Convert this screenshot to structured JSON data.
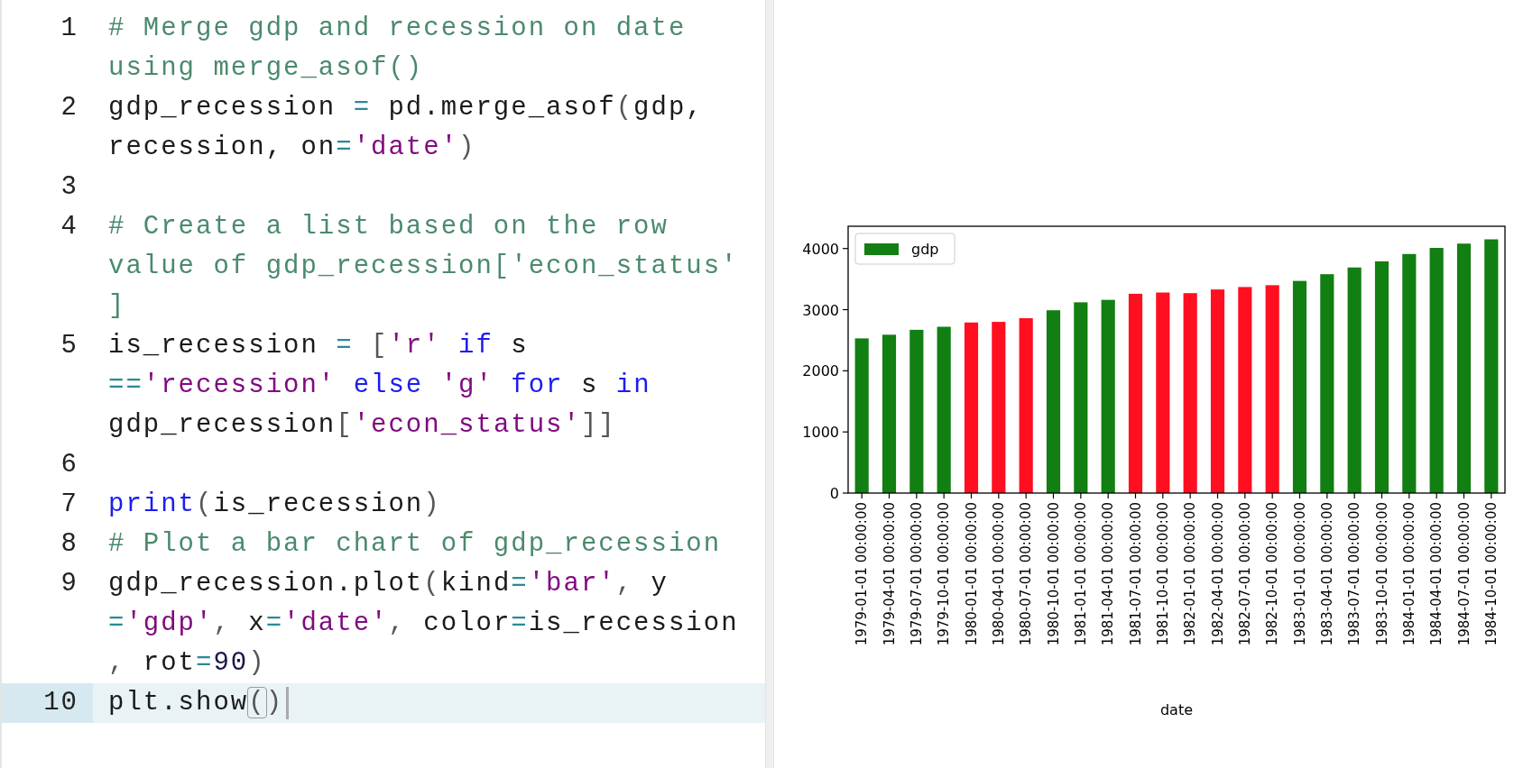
{
  "editor": {
    "lines": [
      {
        "number": "1",
        "active": false,
        "rows": [
          {
            "tokens": [
              {
                "kind": "comment",
                "text": "# Merge gdp and recession on date"
              }
            ]
          },
          {
            "tokens": [
              {
                "kind": "comment",
                "text": "using merge_asof()"
              }
            ]
          }
        ]
      },
      {
        "number": "2",
        "active": false,
        "rows": [
          {
            "tokens": [
              {
                "kind": "name",
                "text": "gdp_recession "
              },
              {
                "kind": "operator",
                "text": "="
              },
              {
                "kind": "name",
                "text": " pd.merge_asof"
              },
              {
                "kind": "punct",
                "text": "("
              },
              {
                "kind": "name",
                "text": "gdp,"
              }
            ]
          },
          {
            "tokens": [
              {
                "kind": "name",
                "text": "recession, on"
              },
              {
                "kind": "operator",
                "text": "="
              },
              {
                "kind": "string",
                "text": "'date'"
              },
              {
                "kind": "punct",
                "text": ")"
              }
            ]
          }
        ]
      },
      {
        "number": "3",
        "active": false,
        "rows": [
          {
            "tokens": []
          }
        ]
      },
      {
        "number": "4",
        "active": false,
        "rows": [
          {
            "tokens": [
              {
                "kind": "comment",
                "text": "# Create a list based on the row"
              }
            ]
          },
          {
            "tokens": [
              {
                "kind": "comment",
                "text": "value of gdp_recession['econ_status'"
              }
            ]
          },
          {
            "tokens": [
              {
                "kind": "comment",
                "text": "]"
              }
            ]
          }
        ]
      },
      {
        "number": "5",
        "active": false,
        "rows": [
          {
            "tokens": [
              {
                "kind": "name",
                "text": "is_recession "
              },
              {
                "kind": "operator",
                "text": "="
              },
              {
                "kind": "punct",
                "text": " ["
              },
              {
                "kind": "string",
                "text": "'r'"
              },
              {
                "kind": "keyword",
                "text": " if"
              },
              {
                "kind": "name",
                "text": " s"
              }
            ]
          },
          {
            "tokens": [
              {
                "kind": "operator",
                "text": "=="
              },
              {
                "kind": "string",
                "text": "'recession'"
              },
              {
                "kind": "keyword",
                "text": " else"
              },
              {
                "kind": "string",
                "text": " 'g'"
              },
              {
                "kind": "keyword",
                "text": " for"
              },
              {
                "kind": "name",
                "text": " s"
              },
              {
                "kind": "keyword",
                "text": " in"
              }
            ]
          },
          {
            "tokens": [
              {
                "kind": "name",
                "text": "gdp_recession"
              },
              {
                "kind": "punct",
                "text": "["
              },
              {
                "kind": "string",
                "text": "'econ_status'"
              },
              {
                "kind": "punct",
                "text": "]]"
              }
            ]
          }
        ]
      },
      {
        "number": "6",
        "active": false,
        "rows": [
          {
            "tokens": []
          }
        ]
      },
      {
        "number": "7",
        "active": false,
        "rows": [
          {
            "tokens": [
              {
                "kind": "keyword",
                "text": "print"
              },
              {
                "kind": "punct",
                "text": "("
              },
              {
                "kind": "name",
                "text": "is_recession"
              },
              {
                "kind": "punct",
                "text": ")"
              }
            ]
          }
        ]
      },
      {
        "number": "8",
        "active": false,
        "rows": [
          {
            "tokens": [
              {
                "kind": "comment",
                "text": "# Plot a bar chart of gdp_recession"
              }
            ]
          }
        ]
      },
      {
        "number": "9",
        "active": false,
        "rows": [
          {
            "tokens": [
              {
                "kind": "name",
                "text": "gdp_recession.plot"
              },
              {
                "kind": "punct",
                "text": "("
              },
              {
                "kind": "name",
                "text": "kind"
              },
              {
                "kind": "operator",
                "text": "="
              },
              {
                "kind": "string",
                "text": "'bar'"
              },
              {
                "kind": "punct",
                "text": ", "
              },
              {
                "kind": "name",
                "text": "y"
              }
            ]
          },
          {
            "tokens": [
              {
                "kind": "operator",
                "text": "="
              },
              {
                "kind": "string",
                "text": "'gdp'"
              },
              {
                "kind": "punct",
                "text": ", "
              },
              {
                "kind": "name",
                "text": "x"
              },
              {
                "kind": "operator",
                "text": "="
              },
              {
                "kind": "string",
                "text": "'date'"
              },
              {
                "kind": "punct",
                "text": ", "
              },
              {
                "kind": "name",
                "text": "color"
              },
              {
                "kind": "operator",
                "text": "="
              },
              {
                "kind": "name",
                "text": "is_recession"
              }
            ]
          },
          {
            "tokens": [
              {
                "kind": "punct",
                "text": ", "
              },
              {
                "kind": "name",
                "text": "rot"
              },
              {
                "kind": "operator",
                "text": "="
              },
              {
                "kind": "number",
                "text": "90"
              },
              {
                "kind": "punct",
                "text": ")"
              }
            ]
          }
        ]
      },
      {
        "number": "10",
        "active": true,
        "rows": [
          {
            "tokens": [
              {
                "kind": "name",
                "text": "plt.show"
              },
              {
                "kind": "matched_bracket",
                "text": "("
              },
              {
                "kind": "punct",
                "text": ")"
              }
            ]
          }
        ]
      }
    ]
  },
  "plot": {
    "chart_data": {
      "type": "bar",
      "xlabel": "date",
      "ylim": [
        0,
        4364
      ],
      "yticks": [
        0,
        1000,
        2000,
        3000,
        4000
      ],
      "categories": [
        "1979-01-01 00:00:00",
        "1979-04-01 00:00:00",
        "1979-07-01 00:00:00",
        "1979-10-01 00:00:00",
        "1980-01-01 00:00:00",
        "1980-04-01 00:00:00",
        "1980-07-01 00:00:00",
        "1980-10-01 00:00:00",
        "1981-01-01 00:00:00",
        "1981-04-01 00:00:00",
        "1981-07-01 00:00:00",
        "1981-10-01 00:00:00",
        "1982-01-01 00:00:00",
        "1982-04-01 00:00:00",
        "1982-07-01 00:00:00",
        "1982-10-01 00:00:00",
        "1983-01-01 00:00:00",
        "1983-04-01 00:00:00",
        "1983-07-01 00:00:00",
        "1983-10-01 00:00:00",
        "1984-01-01 00:00:00",
        "1984-04-01 00:00:00",
        "1984-07-01 00:00:00",
        "1984-10-01 00:00:00"
      ],
      "series": [
        {
          "name": "gdp",
          "color": "#117f11",
          "values": [
            2530,
            2590,
            2670,
            2720,
            2790,
            2800,
            2860,
            2990,
            3120,
            3160,
            3260,
            3280,
            3270,
            3330,
            3370,
            3400,
            3470,
            3580,
            3690,
            3790,
            3910,
            4010,
            4080,
            4150
          ],
          "colors": [
            "#117f11",
            "#117f11",
            "#117f11",
            "#117f11",
            "#ff0f1f",
            "#ff0f1f",
            "#ff0f1f",
            "#117f11",
            "#117f11",
            "#117f11",
            "#ff0f1f",
            "#ff0f1f",
            "#ff0f1f",
            "#ff0f1f",
            "#ff0f1f",
            "#ff0f1f",
            "#117f11",
            "#117f11",
            "#117f11",
            "#117f11",
            "#117f11",
            "#117f11",
            "#117f11",
            "#117f11"
          ]
        }
      ]
    }
  }
}
